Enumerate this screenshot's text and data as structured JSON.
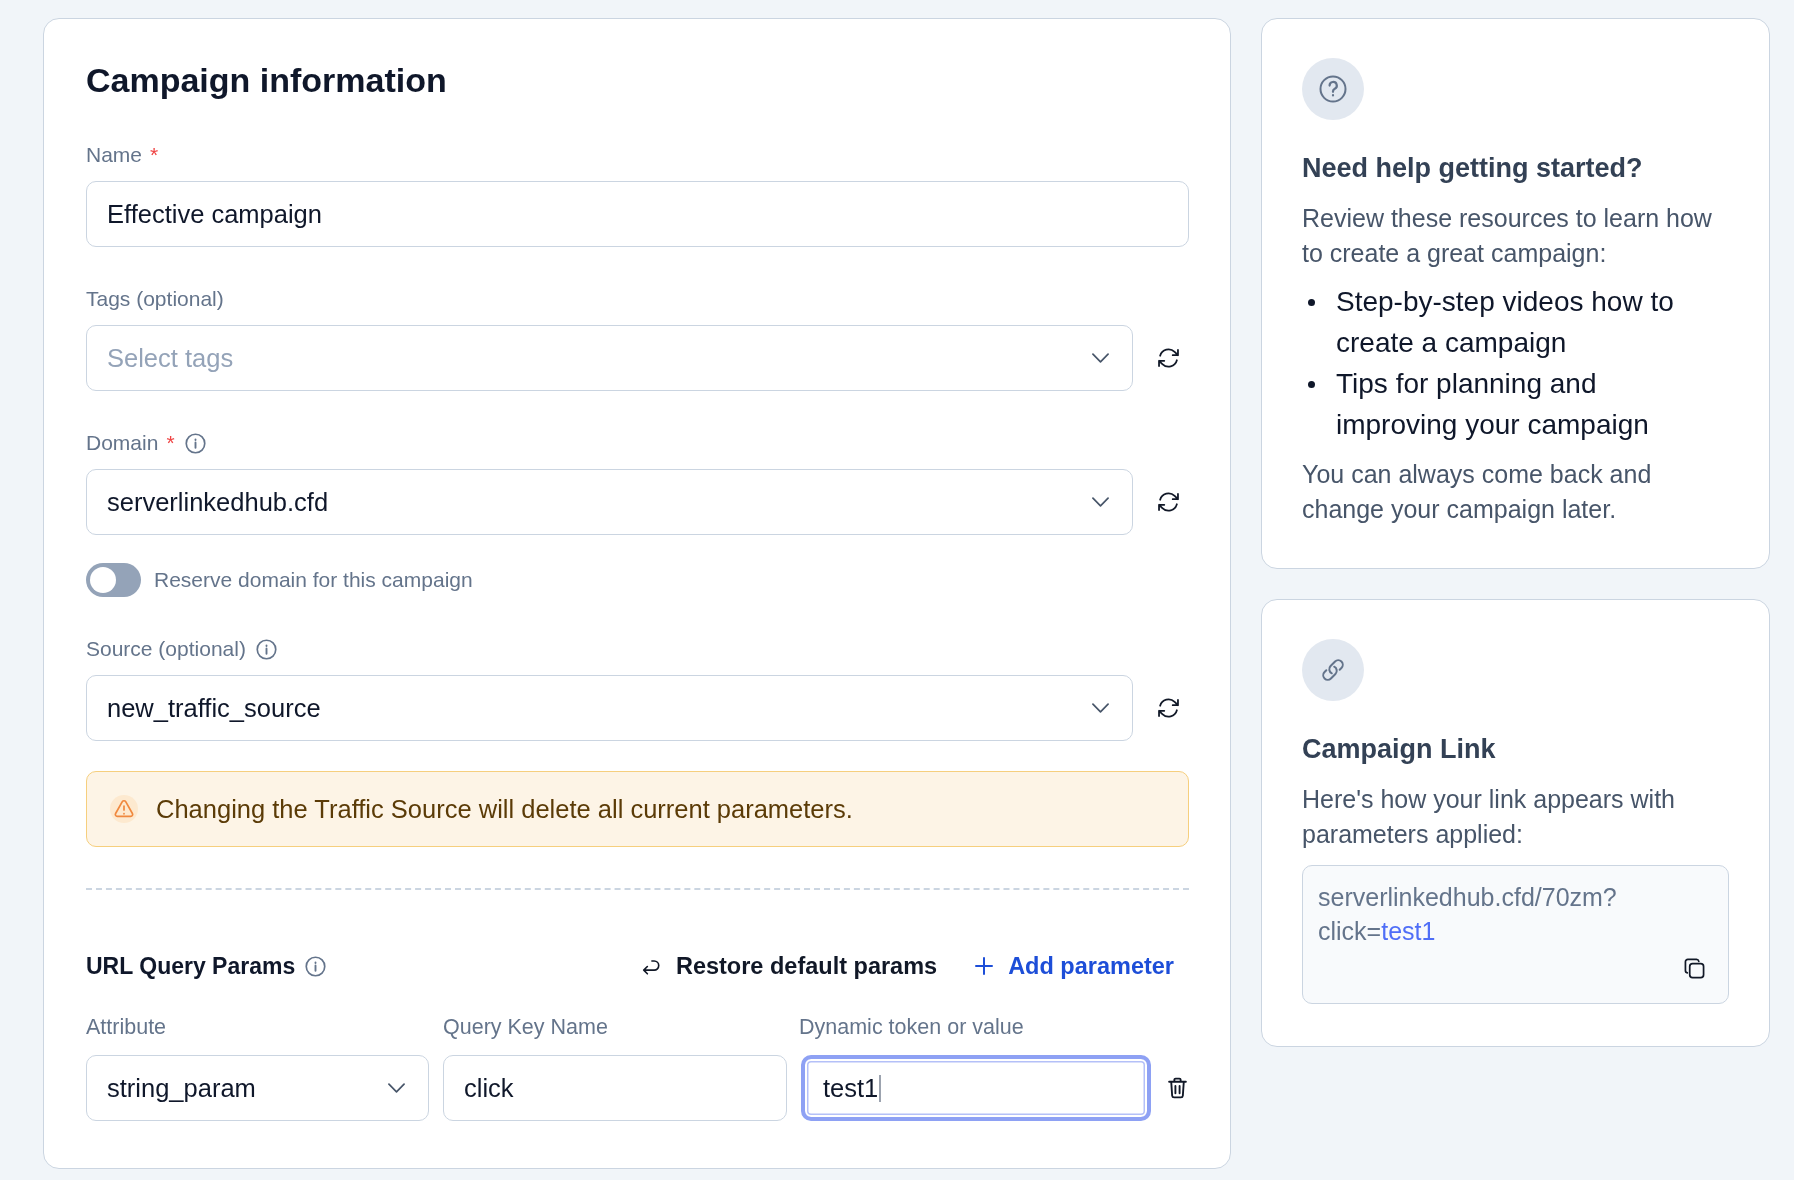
{
  "form": {
    "title": "Campaign information",
    "fields": [
      {
        "kind": "text",
        "label": "Name",
        "required_mark": "*",
        "value": "Effective campaign"
      },
      {
        "kind": "select",
        "label": "Tags (optional)",
        "placeholder": "Select tags"
      },
      {
        "kind": "select",
        "label": "Domain",
        "required_mark": "*",
        "info": true,
        "value": "serverlinkedhub.cfd"
      },
      {
        "kind": "toggle",
        "label": "Reserve domain for this campaign",
        "on": false
      },
      {
        "kind": "select",
        "label": "Source (optional)",
        "info": true,
        "value": "new_traffic_source"
      },
      {
        "kind": "alert",
        "text": "Changing the Traffic Source will delete all current parameters."
      }
    ]
  },
  "params": {
    "title": "URL Query Params",
    "info": true,
    "restore_label": "Restore default params",
    "add_label": "Add parameter",
    "columns": [
      "Attribute",
      "Query Key Name",
      "Dynamic token or value"
    ],
    "rows": [
      {
        "attribute": "string_param",
        "key": "click",
        "value": "test1",
        "focused": true
      }
    ]
  },
  "help_card": {
    "title": "Need help getting started?",
    "intro": "Review these resources to learn how to create a great campaign:",
    "items": [
      "Step-by-step videos how to create a campaign",
      "Tips for planning and improving your campaign"
    ],
    "footer": "You can always come back and change your campaign later."
  },
  "link_card": {
    "title": "Campaign Link",
    "description": "Here's how your link appears with parameters applied:",
    "url_path": "serverlinkedhub.cfd/70zm?",
    "url_query": "click=",
    "url_value": "test1"
  }
}
